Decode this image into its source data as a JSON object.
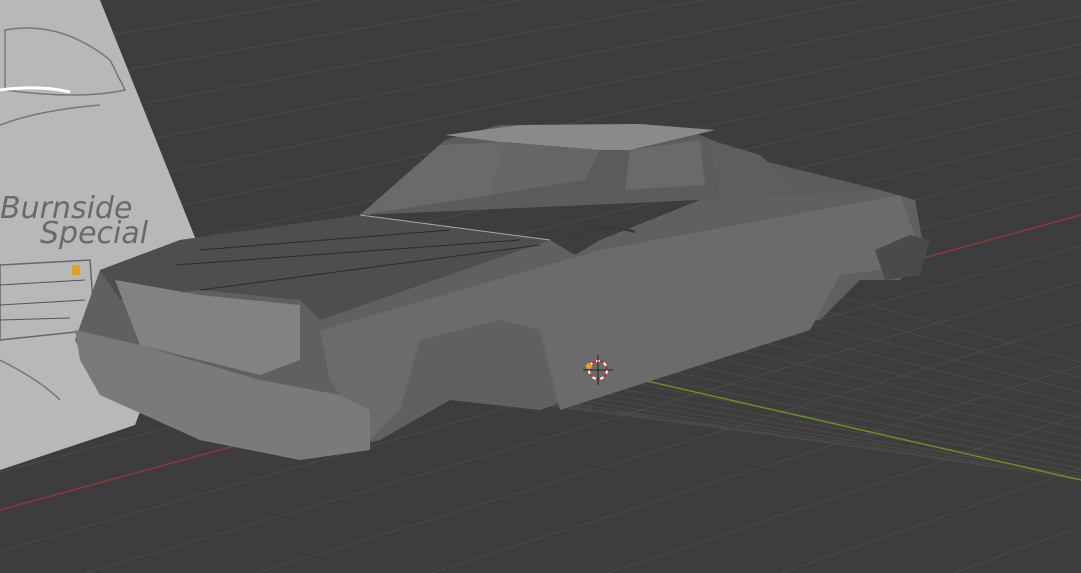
{
  "viewport": {
    "background": "#3d3d3d",
    "x_axis_color": "#8a3a3f",
    "y_axis_color": "#6a8c2a"
  },
  "reference_image": {
    "text_line1": "Burnside",
    "text_line2": "Special"
  },
  "object": {
    "name_icon": "car-body-mesh"
  }
}
